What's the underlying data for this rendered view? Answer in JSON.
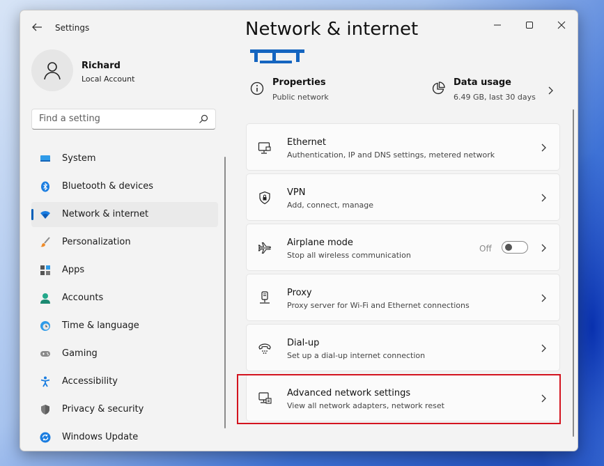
{
  "window": {
    "app_title": "Settings"
  },
  "profile": {
    "name": "Richard",
    "account_type": "Local Account"
  },
  "search": {
    "placeholder": "Find a setting"
  },
  "sidebar": {
    "items": [
      {
        "label": "System",
        "icon": "system-icon",
        "active": false
      },
      {
        "label": "Bluetooth & devices",
        "icon": "bluetooth-icon",
        "active": false
      },
      {
        "label": "Network & internet",
        "icon": "wifi-icon",
        "active": true
      },
      {
        "label": "Personalization",
        "icon": "brush-icon",
        "active": false
      },
      {
        "label": "Apps",
        "icon": "apps-icon",
        "active": false
      },
      {
        "label": "Accounts",
        "icon": "accounts-icon",
        "active": false
      },
      {
        "label": "Time & language",
        "icon": "clock-icon",
        "active": false
      },
      {
        "label": "Gaming",
        "icon": "gamepad-icon",
        "active": false
      },
      {
        "label": "Accessibility",
        "icon": "accessibility-icon",
        "active": false
      },
      {
        "label": "Privacy & security",
        "icon": "shield-icon",
        "active": false
      },
      {
        "label": "Windows Update",
        "icon": "update-icon",
        "active": false
      }
    ]
  },
  "main": {
    "title": "Network & internet",
    "properties": {
      "title": "Properties",
      "subtitle": "Public network",
      "icon": "info-icon"
    },
    "data_usage": {
      "title": "Data usage",
      "subtitle": "6.49 GB, last 30 days",
      "icon": "pie-chart-icon"
    },
    "cards": [
      {
        "title": "Ethernet",
        "subtitle": "Authentication, IP and DNS settings, metered network",
        "icon": "ethernet-icon"
      },
      {
        "title": "VPN",
        "subtitle": "Add, connect, manage",
        "icon": "vpn-shield-icon"
      },
      {
        "title": "Airplane mode",
        "subtitle": "Stop all wireless communication",
        "icon": "airplane-icon",
        "toggle_label": "Off",
        "toggle_on": false
      },
      {
        "title": "Proxy",
        "subtitle": "Proxy server for Wi-Fi and Ethernet connections",
        "icon": "proxy-icon"
      },
      {
        "title": "Dial-up",
        "subtitle": "Set up a dial-up internet connection",
        "icon": "dialup-icon"
      },
      {
        "title": "Advanced network settings",
        "subtitle": "View all network adapters, network reset",
        "icon": "advanced-network-icon",
        "highlighted": true
      }
    ]
  },
  "colors": {
    "accent": "#005fb8",
    "highlight_border": "#d3131e",
    "window_bg": "#f3f3f3",
    "card_bg": "#fbfbfb"
  }
}
